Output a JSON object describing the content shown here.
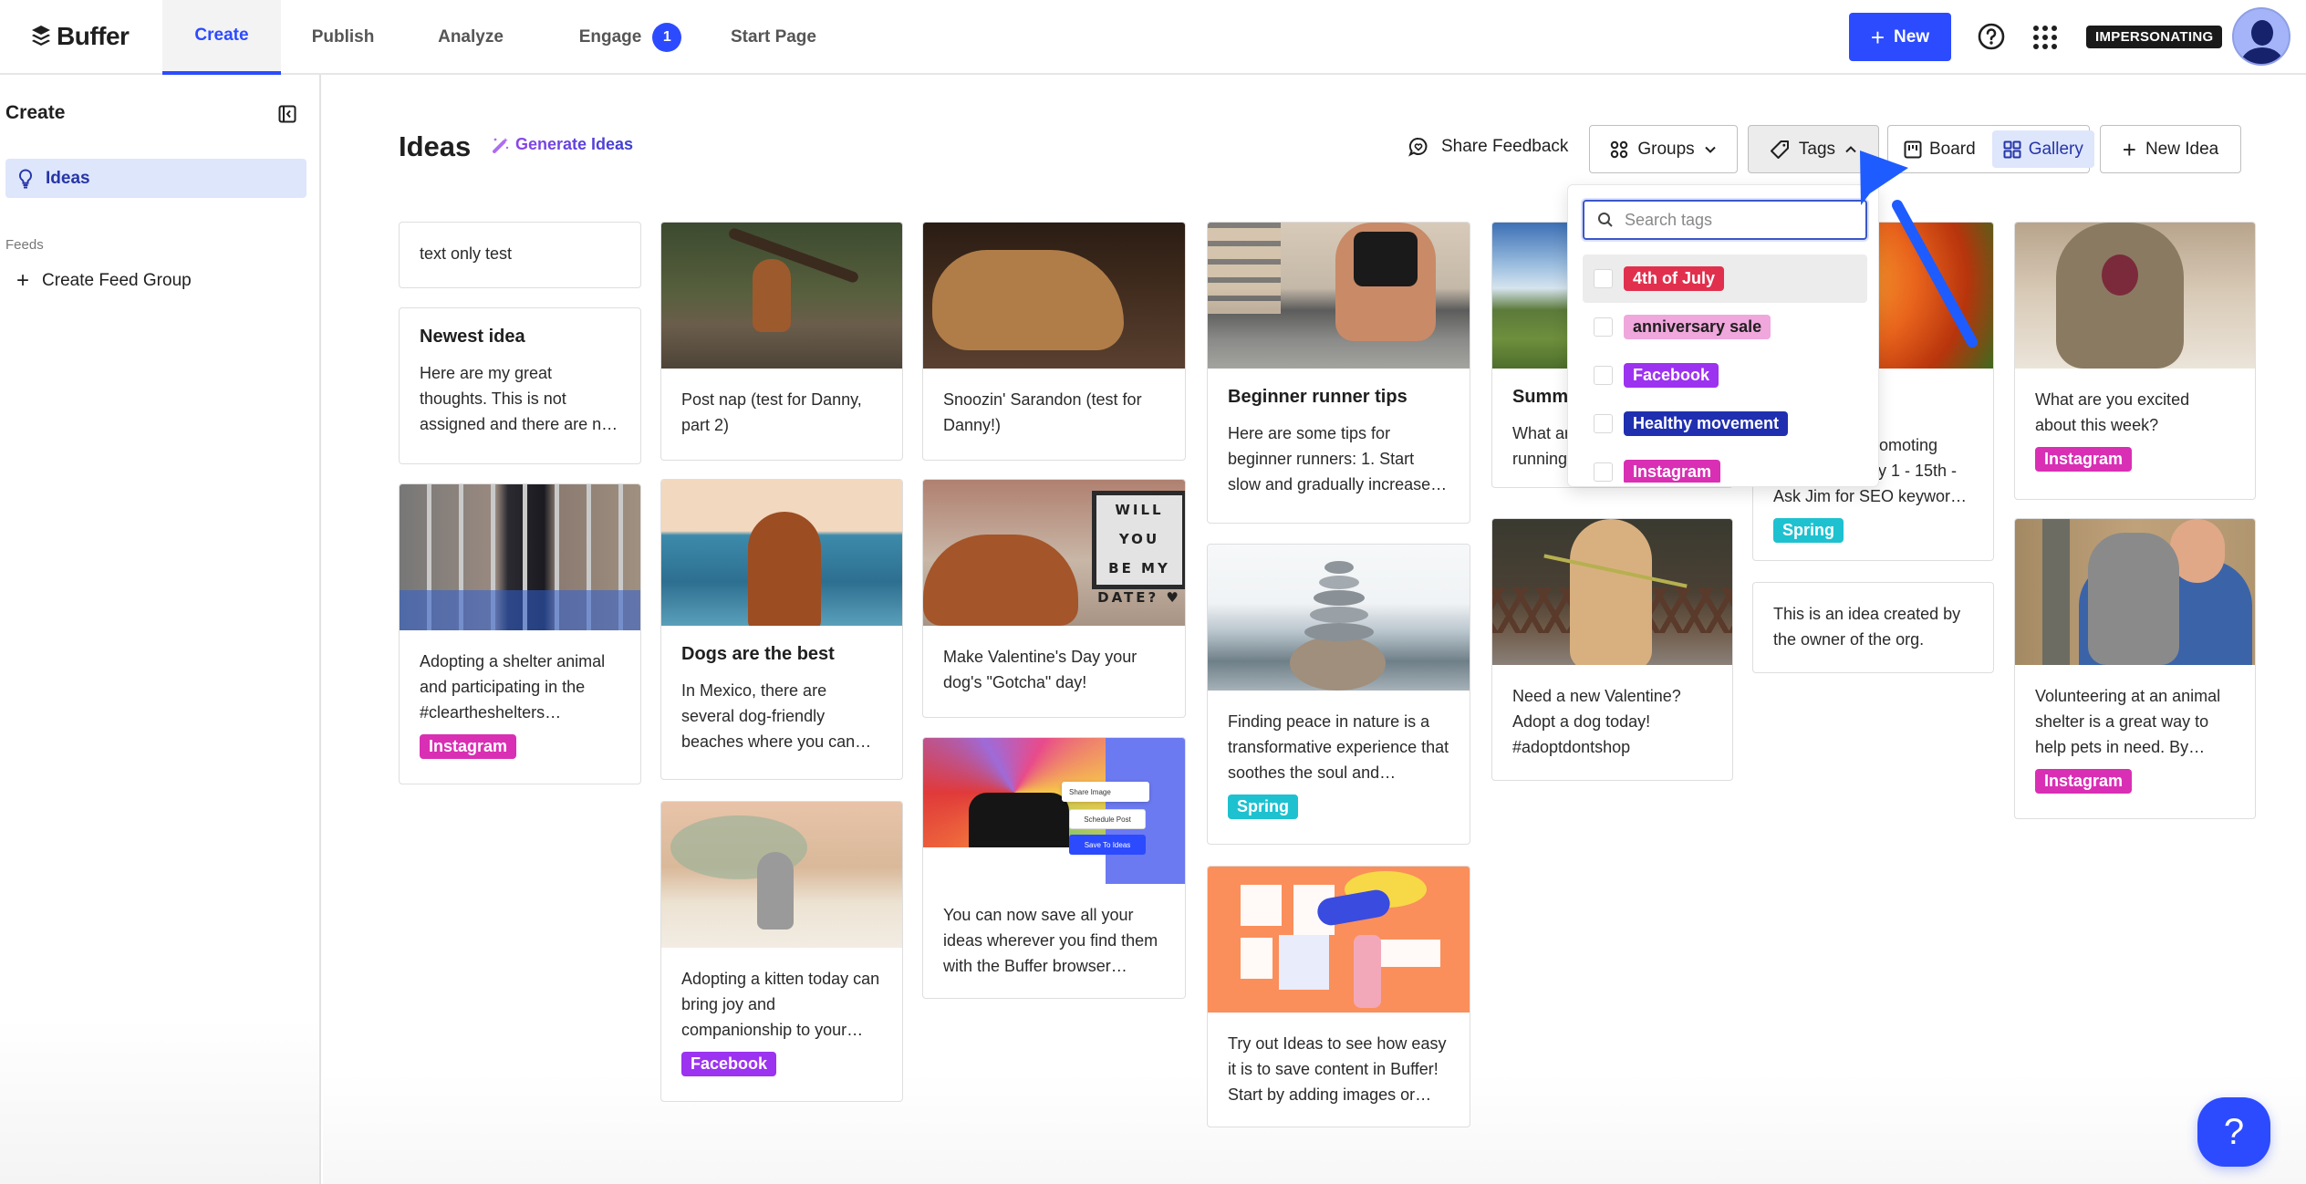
{
  "app": {
    "brand": "Buffer"
  },
  "nav": {
    "tabs": [
      {
        "label": "Create",
        "active": true
      },
      {
        "label": "Publish"
      },
      {
        "label": "Analyze"
      },
      {
        "label": "Engage",
        "badge": "1"
      },
      {
        "label": "Start Page"
      }
    ],
    "new_label": "New",
    "impersonating_label": "IMPERSONATING"
  },
  "sidebar": {
    "title": "Create",
    "items": [
      {
        "label": "Ideas",
        "icon": "lightbulb-icon",
        "active": true
      }
    ],
    "feeds_label": "Feeds",
    "create_feed_label": "Create Feed Group"
  },
  "header": {
    "title": "Ideas",
    "generate_label": "Generate Ideas",
    "share_feedback_label": "Share Feedback",
    "groups_label": "Groups",
    "tags_label": "Tags",
    "board_label": "Board",
    "gallery_label": "Gallery",
    "new_idea_label": "New Idea"
  },
  "tags_dropdown": {
    "search_placeholder": "Search tags",
    "search_value": "",
    "items": [
      {
        "label": "4th of July",
        "color": "#e0304e",
        "text_color": "#ffffff",
        "checked": false
      },
      {
        "label": "anniversary sale",
        "color": "#f0a8dc",
        "text_color": "#1f1f1f",
        "checked": false
      },
      {
        "label": "Facebook",
        "color": "#9b33f0",
        "text_color": "#ffffff",
        "checked": false
      },
      {
        "label": "Healthy movement",
        "color": "#1f2fb0",
        "text_color": "#ffffff",
        "checked": false
      },
      {
        "label": "Instagram",
        "color": "#d92fb4",
        "text_color": "#ffffff",
        "checked": false
      }
    ]
  },
  "colors": {
    "accent": "#2c4bff",
    "instagram": "#d92fb4",
    "facebook": "#9b33f0",
    "spring": "#1ec1cf"
  },
  "cards": [
    {
      "text": "text only test"
    },
    {
      "title": "Newest idea",
      "text": "Here are my great thoughts. This is not assigned and there are n…"
    },
    {
      "image": "black-kitten-cage",
      "text": "Adopting a shelter animal and participating in the #cleartheshelters…",
      "tag": "Instagram"
    },
    {
      "image": "dog-with-stick",
      "text": "Post nap (test for Danny, part 2)"
    },
    {
      "image": "dog-beach",
      "title": "Dogs are the best",
      "text": "In Mexico, there are several dog-friendly beaches where you can…"
    },
    {
      "image": "kitten-bed",
      "text": "Adopting a kitten today can bring joy and companionship to your…",
      "tag": "Facebook"
    },
    {
      "image": "sleeping-dog",
      "text": "Snoozin' Sarandon (test for Danny!)"
    },
    {
      "image": "valentine-dog-sign",
      "text": "Make Valentine's Day your dog's \"Gotcha\" day!"
    },
    {
      "image": "browser-extension-promo",
      "text": "You can now save all your ideas wherever you find them with the Buffer browser…",
      "promo": {
        "share_image": "Share Image",
        "schedule_post": "Schedule Post",
        "save_to_ideas": "Save To Ideas"
      }
    },
    {
      "image": "runner",
      "title": "Beginner runner tips",
      "text": "Here are some tips for beginner runners: 1. Start slow and gradually increase…"
    },
    {
      "image": "stone-stack",
      "text": "Finding peace in nature is a transformative experience that soothes the soul and…",
      "tag": "Spring"
    },
    {
      "image": "ideas-illustration",
      "text": "Try out Ideas to see how easy it is to save content in Buffer! Start by adding images or…"
    },
    {
      "image": "meadow",
      "title": "Summ",
      "text_line1": "What ar",
      "text_line2": "running"
    },
    {
      "image": "dog-with-flower",
      "text": "Need a new Valentine? Adopt a dog today! #adoptdontshop"
    },
    {
      "image": "orange-tulips",
      "text_line1": "promoting",
      "text_line2": "May 1 - 15th -",
      "text_line3": "Ask Jim for SEO keywor…",
      "tag": "Spring"
    },
    {
      "text": "This is an idea created by the owner of the org."
    },
    {
      "image": "yawning-cat",
      "text": "What are you excited about this week?",
      "tag": "Instagram"
    },
    {
      "image": "man-hugging-dog",
      "text": "Volunteering at an animal shelter is a great way to help pets in need. By…",
      "tag": "Instagram"
    }
  ]
}
